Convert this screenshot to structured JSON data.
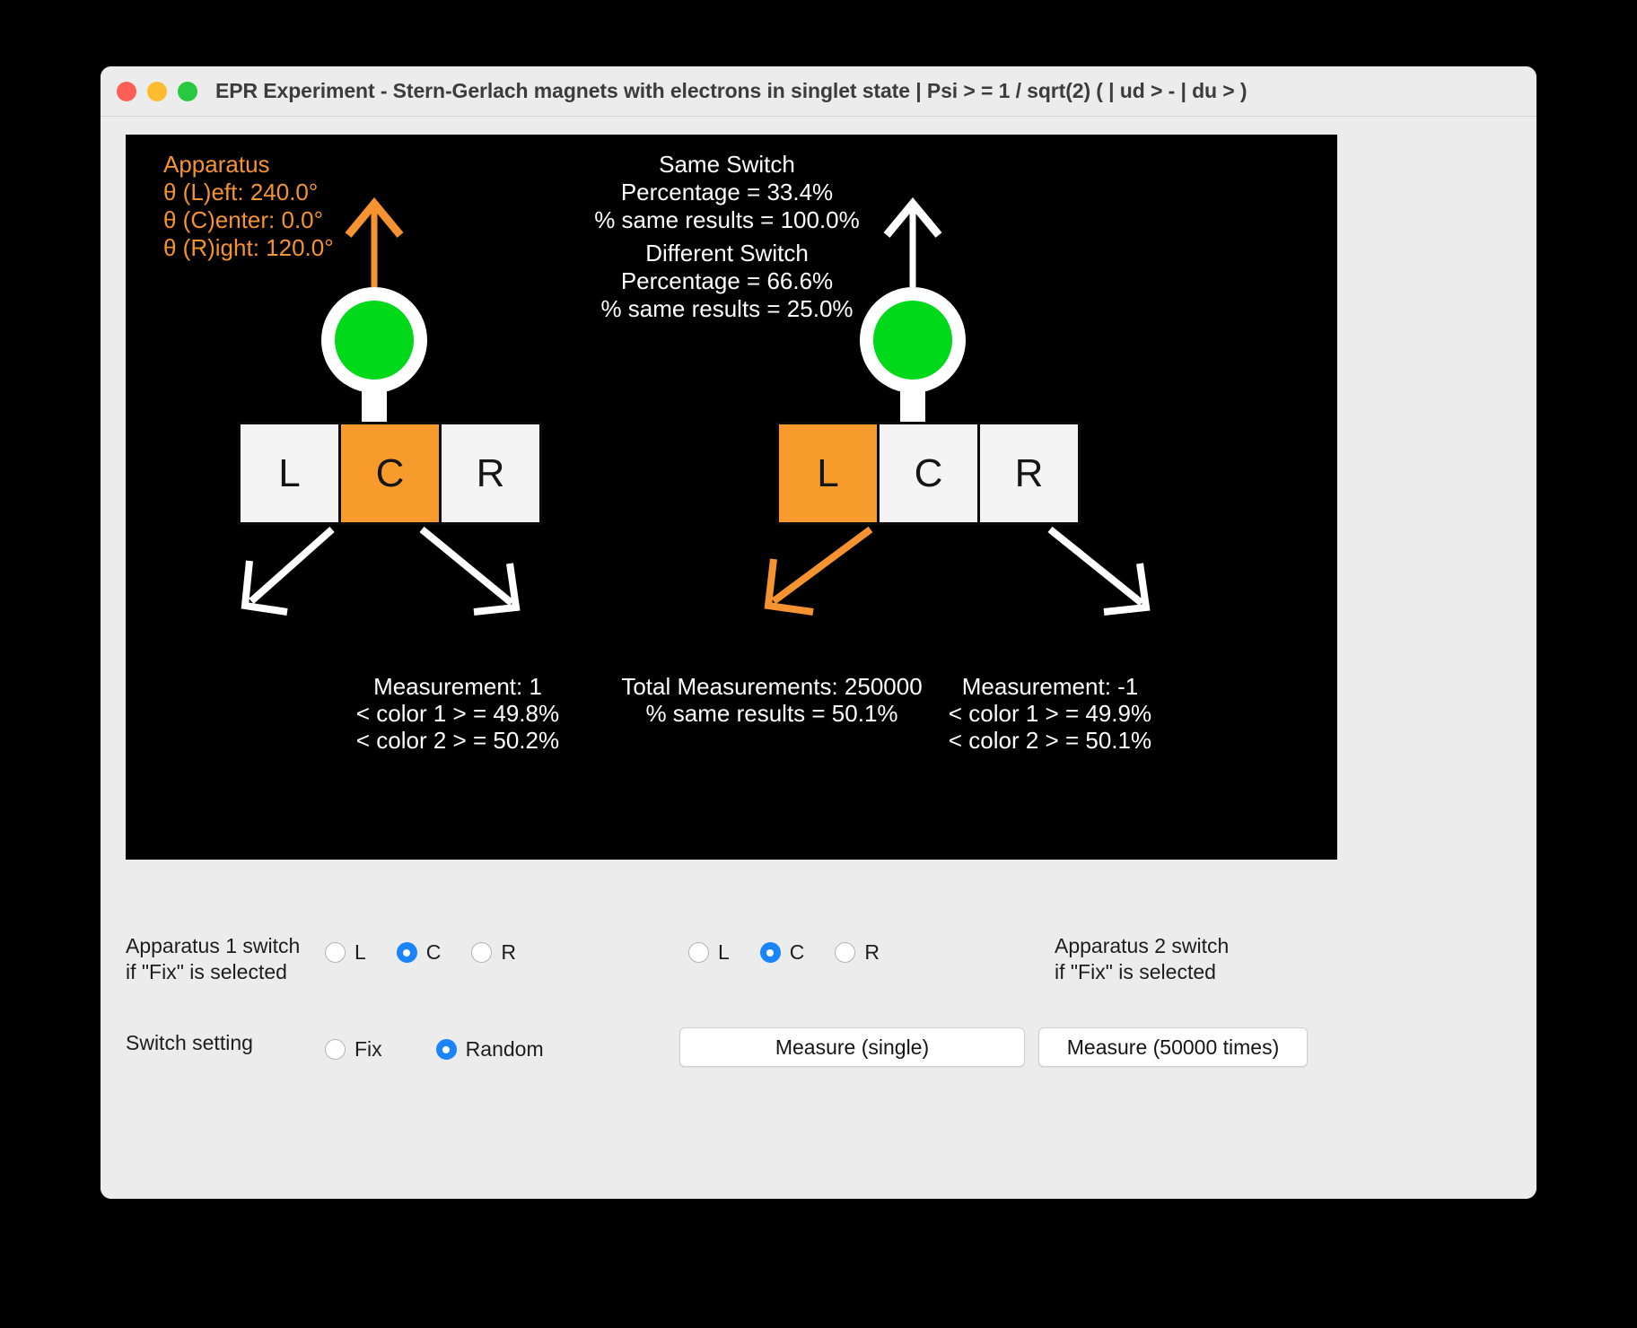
{
  "window": {
    "title": "EPR Experiment - Stern-Gerlach magnets with electrons in singlet state | Psi > = 1 / sqrt(2) ( | ud > - | du > )",
    "traffic_lights": {
      "close_color": "#ff5f57",
      "minimize_color": "#febc2e",
      "maximize_color": "#28c840"
    }
  },
  "canvas": {
    "background": "#000000",
    "accent_color": "#f59331",
    "bulb_color": "#00d919"
  },
  "apparatus_legend": {
    "title": "Apparatus",
    "theta_left": "θ (L)eft: 240.0°",
    "theta_center": "θ (C)enter: 0.0°",
    "theta_right": "θ (R)ight: 120.0°"
  },
  "switch_stats": {
    "same_switch_title": "Same Switch",
    "same_switch_percentage": "Percentage = 33.4%",
    "same_switch_same_results": "% same results = 100.0%",
    "different_switch_title": "Different Switch",
    "different_switch_percentage": "Percentage = 66.6%",
    "different_switch_same_results": "% same results = 25.0%"
  },
  "apparatus_1": {
    "switches": [
      {
        "label": "L",
        "active": false
      },
      {
        "label": "C",
        "active": true
      },
      {
        "label": "R",
        "active": false
      }
    ],
    "bulb_state": "green",
    "up_arrow_color": "#f59331"
  },
  "apparatus_2": {
    "switches": [
      {
        "label": "L",
        "active": true
      },
      {
        "label": "C",
        "active": false
      },
      {
        "label": "R",
        "active": false
      }
    ],
    "bulb_state": "green",
    "up_arrow_color": "#ffffff"
  },
  "measurement_left": {
    "measurement": "Measurement: 1",
    "color1": "< color 1 > = 49.8%",
    "color2": "< color 2 > = 50.2%"
  },
  "measurement_center": {
    "total": "Total Measurements: 250000",
    "same_results": "% same results = 50.1%"
  },
  "measurement_right": {
    "measurement": "Measurement: -1",
    "color1": "< color 1 > = 49.9%",
    "color2": "< color 2 > = 50.1%"
  },
  "controls": {
    "label_apparatus_1_line1": "Apparatus 1 switch",
    "label_apparatus_1_line2": "if \"Fix\" is selected",
    "label_apparatus_2_line1": "Apparatus 2 switch",
    "label_apparatus_2_line2": "if \"Fix\" is selected",
    "label_switch_setting": "Switch setting",
    "apparatus_1_options": [
      {
        "label": "L",
        "selected": false
      },
      {
        "label": "C",
        "selected": true
      },
      {
        "label": "R",
        "selected": false
      }
    ],
    "apparatus_2_options": [
      {
        "label": "L",
        "selected": false
      },
      {
        "label": "C",
        "selected": true
      },
      {
        "label": "R",
        "selected": false
      }
    ],
    "switch_setting_options": [
      {
        "label": "Fix",
        "selected": false
      },
      {
        "label": "Random",
        "selected": true
      }
    ],
    "button_measure_single": "Measure (single)",
    "button_measure_many": "Measure (50000 times)",
    "radio_selected_color": "#1a84fd"
  }
}
